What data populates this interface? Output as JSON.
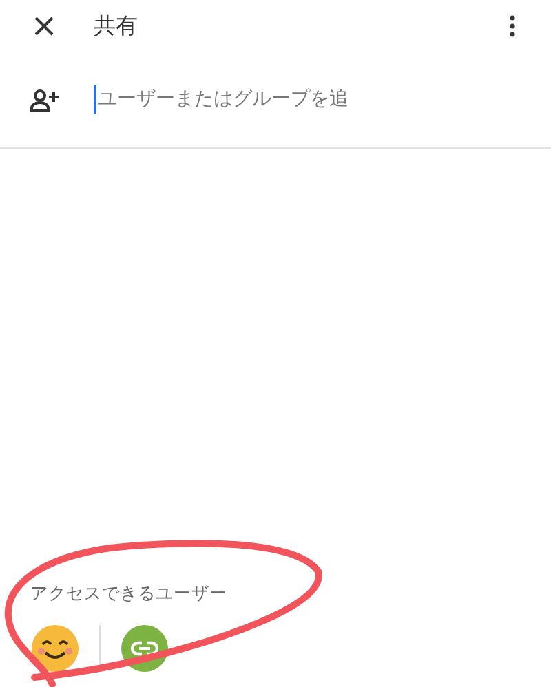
{
  "header": {
    "title": "共有"
  },
  "add_field": {
    "placeholder": "ユーザーまたはグループを追"
  },
  "access": {
    "heading": "アクセスできるユーザー"
  },
  "annotation": {
    "kind": "ellipse",
    "color": "#f2545b"
  }
}
